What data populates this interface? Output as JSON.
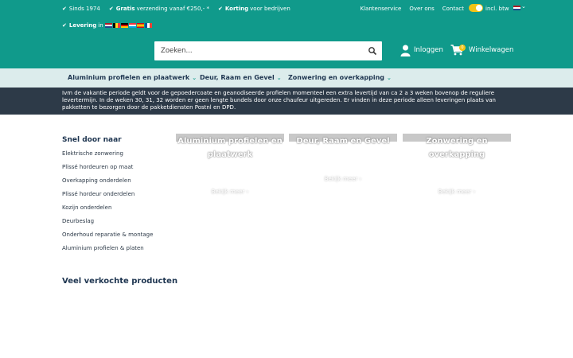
{
  "topbar": {
    "usps": [
      {
        "bold": "",
        "text": "Sinds 1974"
      },
      {
        "bold": "Gratis",
        "text": "verzending vanaf €250,- *"
      },
      {
        "bold": "Korting",
        "text": "voor bedrijven"
      }
    ],
    "links": [
      "Klantenservice",
      "Over ons",
      "Contact"
    ],
    "vat_label": "incl. btw",
    "delivery_bold": "Levering",
    "delivery_text": "in"
  },
  "search": {
    "placeholder": "Zoeken..."
  },
  "account": {
    "login_label": "Inloggen",
    "cart_label": "Winkelwagen",
    "cart_count": "0"
  },
  "nav": {
    "items": [
      "Aluminium profielen en plaatwerk",
      "Deur, Raam en Gevel",
      "Zonwering en overkapping"
    ]
  },
  "notice": "Ivm de vakantie periode geldt voor de gepoedercoate en geanodiseerde profielen momenteel een extra levertijd van ca 2 a 3 weken bovenop de reguliere levertermijn. In de weken 30, 31, 32 worden er geen lengte bundels door onze chaufeur uitgereden. Er vinden in deze periode alleen leveringen plaats van pakketten te bezorgen door de pakketdiensten Postnl en DPD.",
  "sidebar": {
    "title": "Snel door naar",
    "items": [
      "Elektrische zonwering",
      "Plissé hordeuren op maat",
      "Overkapping onderdelen",
      "Plissé hordeur onderdelen",
      "Kozijn onderdelen",
      "Deurbeslag",
      "Onderhoud reparatie & montage",
      "Aluminium profielen & platen"
    ]
  },
  "categories": [
    {
      "title": "Aluminium profielen en plaatwerk",
      "more": "Bekijk meer ›"
    },
    {
      "title": "Deur, Raam en Gevel",
      "more": "Bekijk meer ›"
    },
    {
      "title": "Zonwering en overkapping",
      "more": "Bekijk meer ›"
    }
  ],
  "products": {
    "title": "Veel verkochte producten"
  },
  "colors": {
    "brand": "#109a8b",
    "accent": "#f3c316",
    "dark": "#2d3a48",
    "nav_bg": "#dcecec"
  }
}
